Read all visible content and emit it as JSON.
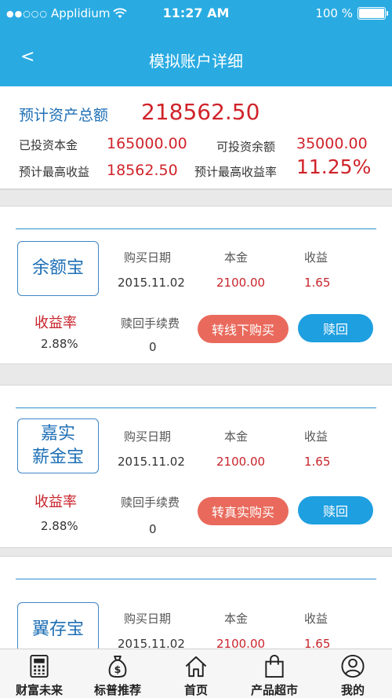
{
  "status": {
    "carrier": "Applidium",
    "time": "11:27 AM",
    "battery": "100 %"
  },
  "nav": {
    "back": "<",
    "title": "模拟账户详细"
  },
  "summary": {
    "total_label": "预计资产总额",
    "total_value": "218562.50",
    "invested_label": "已投资本金",
    "invested_value": "165000.00",
    "available_label": "可投资余额",
    "available_value": "35000.00",
    "max_income_label": "预计最高收益",
    "max_income_value": "18562.50",
    "max_rate_label": "预计最高收益率",
    "max_rate_value": "11.25%"
  },
  "columns": {
    "date": "购买日期",
    "principal": "本金",
    "income": "收益",
    "rate": "收益率",
    "fee": "赎回手续费",
    "redeem": "赎回"
  },
  "products": [
    {
      "name_line1": "余额宝",
      "name_line2": "",
      "date": "2015.11.02",
      "principal": "2100.00",
      "income": "1.65",
      "rate": "2.88%",
      "fee": "0",
      "action": "转线下购买"
    },
    {
      "name_line1": "嘉实",
      "name_line2": "薪金宝",
      "date": "2015.11.02",
      "principal": "2100.00",
      "income": "1.65",
      "rate": "2.88%",
      "fee": "0",
      "action": "转真实购买"
    },
    {
      "name_line1": "翼存宝",
      "name_line2": "",
      "date": "2015.11.02",
      "principal": "2100.00",
      "income": "1.65"
    }
  ],
  "tabs": [
    {
      "label": "财富未来",
      "icon": "calculator-icon"
    },
    {
      "label": "标普推荐",
      "icon": "money-bag-icon"
    },
    {
      "label": "首页",
      "icon": "home-icon"
    },
    {
      "label": "产品超市",
      "icon": "shopping-bag-icon"
    },
    {
      "label": "我的",
      "icon": "user-icon"
    }
  ],
  "colors": {
    "header": "#29abe2",
    "accent_red": "#d0232a",
    "sale_button": "#e96a5c",
    "redeem_button": "#1e9fe0"
  }
}
